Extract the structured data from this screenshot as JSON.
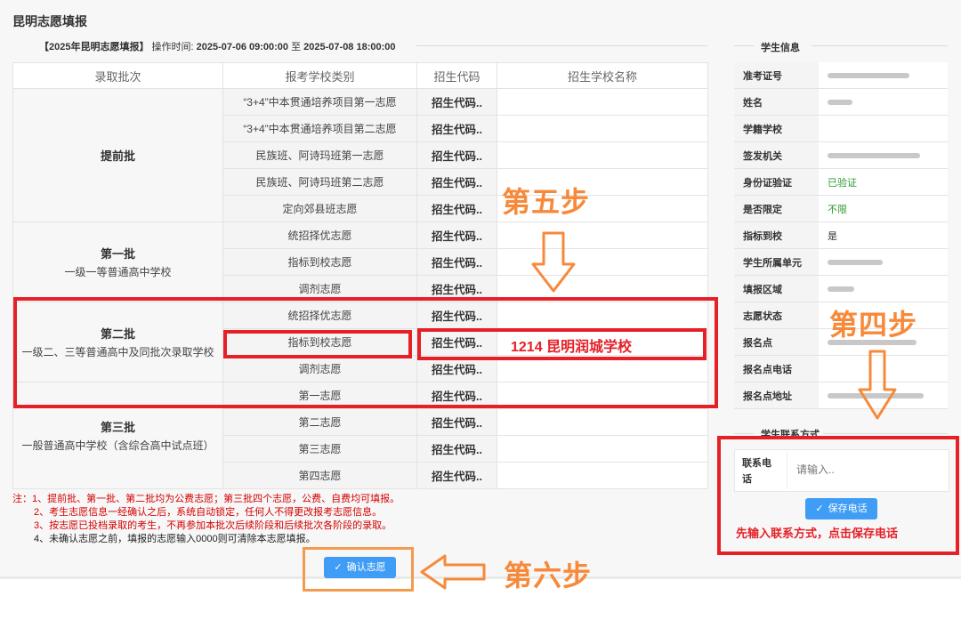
{
  "page_title": "昆明志愿填报",
  "op_time": {
    "prefix": "【2025年昆明志愿填报】",
    "label": "操作时间:",
    "start": "2025-07-06 09:00:00",
    "to": "至",
    "end": "2025-07-08 18:00:00"
  },
  "table": {
    "headers": [
      "录取批次",
      "报考学校类别",
      "招生代码",
      "招生学校名称"
    ],
    "batches": {
      "early": {
        "title": "提前批",
        "sub": ""
      },
      "first": {
        "title": "第一批",
        "sub": "一级一等普通高中学校"
      },
      "second": {
        "title": "第二批",
        "sub": "一级二、三等普通高中及同批次录取学校"
      },
      "third": {
        "title": "第三批",
        "sub": "一般普通高中学校（含综合高中试点班）"
      }
    },
    "rows": [
      {
        "category": "“3+4”中本贯通培养项目第一志愿",
        "code": "招生代码..",
        "school": ""
      },
      {
        "category": "“3+4”中本贯通培养项目第二志愿",
        "code": "招生代码..",
        "school": ""
      },
      {
        "category": "民族班、阿诗玛班第一志愿",
        "code": "招生代码..",
        "school": ""
      },
      {
        "category": "民族班、阿诗玛班第二志愿",
        "code": "招生代码..",
        "school": ""
      },
      {
        "category": "定向郊县班志愿",
        "code": "招生代码..",
        "school": ""
      },
      {
        "category": "统招择优志愿",
        "code": "招生代码..",
        "school": ""
      },
      {
        "category": "指标到校志愿",
        "code": "招生代码..",
        "school": ""
      },
      {
        "category": "调剂志愿",
        "code": "招生代码..",
        "school": ""
      },
      {
        "category": "统招择优志愿",
        "code": "招生代码..",
        "school": ""
      },
      {
        "category": "指标到校志愿",
        "code": "招生代码..",
        "school": ""
      },
      {
        "category": "调剂志愿",
        "code": "招生代码..",
        "school": ""
      },
      {
        "category": "第一志愿",
        "code": "招生代码..",
        "school": ""
      },
      {
        "category": "第二志愿",
        "code": "招生代码..",
        "school": ""
      },
      {
        "category": "第三志愿",
        "code": "招生代码..",
        "school": ""
      },
      {
        "category": "第四志愿",
        "code": "招生代码..",
        "school": ""
      }
    ]
  },
  "student_info": {
    "heading": "学生信息",
    "rows": [
      {
        "label": "准考证号",
        "value": ""
      },
      {
        "label": "姓名",
        "value": ""
      },
      {
        "label": "学籍学校",
        "value": ""
      },
      {
        "label": "签发机关",
        "value": ""
      },
      {
        "label": "身份证验证",
        "value": "已验证"
      },
      {
        "label": "是否限定",
        "value": "不限"
      },
      {
        "label": "指标到校",
        "value": "是"
      },
      {
        "label": "学生所属单元",
        "value": ""
      },
      {
        "label": "填报区域",
        "value": ""
      },
      {
        "label": "志愿状态",
        "value": ""
      },
      {
        "label": "报名点",
        "value": ""
      },
      {
        "label": "报名点电话",
        "value": ""
      },
      {
        "label": "报名点地址",
        "value": ""
      }
    ]
  },
  "contact": {
    "heading": "学生联系方式",
    "label": "联系电话",
    "placeholder": "请输入..",
    "save_button": "保存电话",
    "hint": "先输入联系方式，点击保存电话"
  },
  "notes": [
    "注：1、提前批、第一批、第二批均为公费志愿；第三批四个志愿，公费、自费均可填报。",
    "2、考生志愿信息一经确认之后，系统自动锁定，任何人不得更改报考志愿信息。",
    "3、按志愿已投档录取的考生，不再参加本批次后续阶段和后续批次各阶段的录取。",
    "4、未确认志愿之前，填报的志愿输入0000则可清除本志愿填报。"
  ],
  "confirm_button": "确认志愿",
  "annotations": {
    "step4": "第四步",
    "step5": "第五步",
    "step6": "第六步",
    "school_entry": "1214 昆明润城学校"
  },
  "colors": {
    "annotation_red": "#e52027",
    "annotation_orange": "#f7893a",
    "button_blue": "#3f9df5",
    "verified_green": "#2e9a2e"
  }
}
